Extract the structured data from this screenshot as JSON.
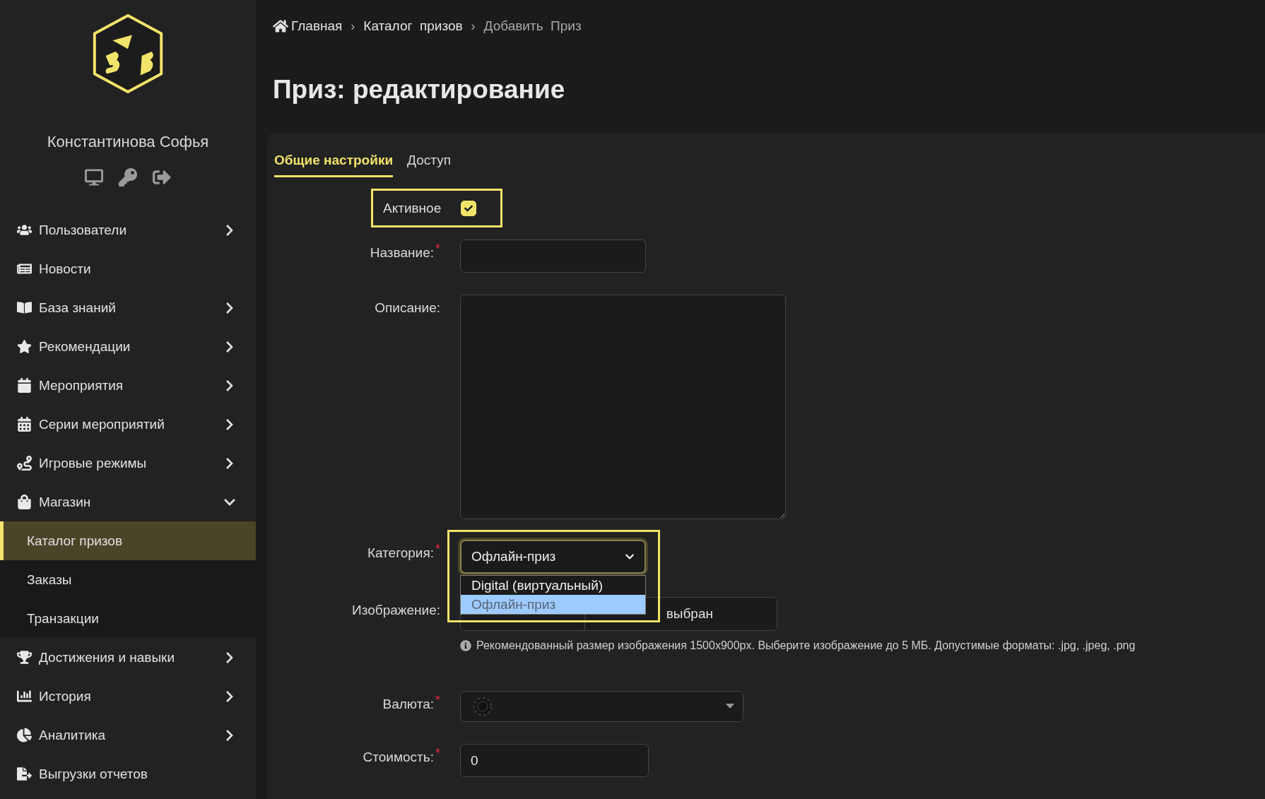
{
  "sidebar": {
    "user_name": "Константинова Софья",
    "items": [
      {
        "label": "Пользователи",
        "has_children": true,
        "expanded": false
      },
      {
        "label": "Новости",
        "has_children": false,
        "expanded": false
      },
      {
        "label": "База знаний",
        "has_children": true,
        "expanded": false
      },
      {
        "label": "Рекомендации",
        "has_children": true,
        "expanded": false
      },
      {
        "label": "Мероприятия",
        "has_children": true,
        "expanded": false
      },
      {
        "label": "Серии мероприятий",
        "has_children": true,
        "expanded": false
      },
      {
        "label": "Игровые режимы",
        "has_children": true,
        "expanded": false
      },
      {
        "label": "Магазин",
        "has_children": true,
        "expanded": true,
        "children": [
          {
            "label": "Каталог призов",
            "selected": true
          },
          {
            "label": "Заказы",
            "selected": false
          },
          {
            "label": "Транзакции",
            "selected": false
          }
        ]
      },
      {
        "label": "Достижения и навыки",
        "has_children": true,
        "expanded": false
      },
      {
        "label": "История",
        "has_children": true,
        "expanded": false
      },
      {
        "label": "Аналитика",
        "has_children": true,
        "expanded": false
      },
      {
        "label": "Выгрузки отчетов",
        "has_children": false,
        "expanded": false
      }
    ]
  },
  "breadcrumbs": [
    {
      "label": "Главная",
      "kind": "home",
      "current": false
    },
    {
      "separator": "›",
      "label": "Каталог  призов",
      "kind": "link",
      "current": false
    },
    {
      "separator": "›",
      "label": "Добавить  Приз",
      "kind": "text",
      "current": true
    }
  ],
  "page_title": "Приз: редактирование",
  "tabs": [
    {
      "label": "Общие настройки",
      "selected": true
    },
    {
      "label": "Доступ",
      "selected": false
    }
  ],
  "form": {
    "active": {
      "label": "Активное",
      "checked": true,
      "highlighted": true
    },
    "name": {
      "label": "Название:",
      "required_mark": "*"
    },
    "description": {
      "label": "Описание:"
    },
    "category": {
      "label": "Категория:",
      "required_mark": "*",
      "value": "Офлайн-приз",
      "open": true,
      "highlighted": true,
      "options": [
        {
          "label": "Digital (виртуальный)",
          "selected": false
        },
        {
          "label": "Офлайн-приз",
          "selected": true
        }
      ]
    },
    "image": {
      "label": "Изображение:",
      "file_status": "выбран",
      "hint": "Рекомендованный размер изображения 1500x900px. Выберите изображение до 5 МБ. Допустимые форматы: .jpg, .jpeg, .png"
    },
    "currency": {
      "label": "Валюта:",
      "required_mark": "*"
    },
    "cost": {
      "label": "Стоимость:",
      "required_mark": "*",
      "value": "0"
    }
  }
}
